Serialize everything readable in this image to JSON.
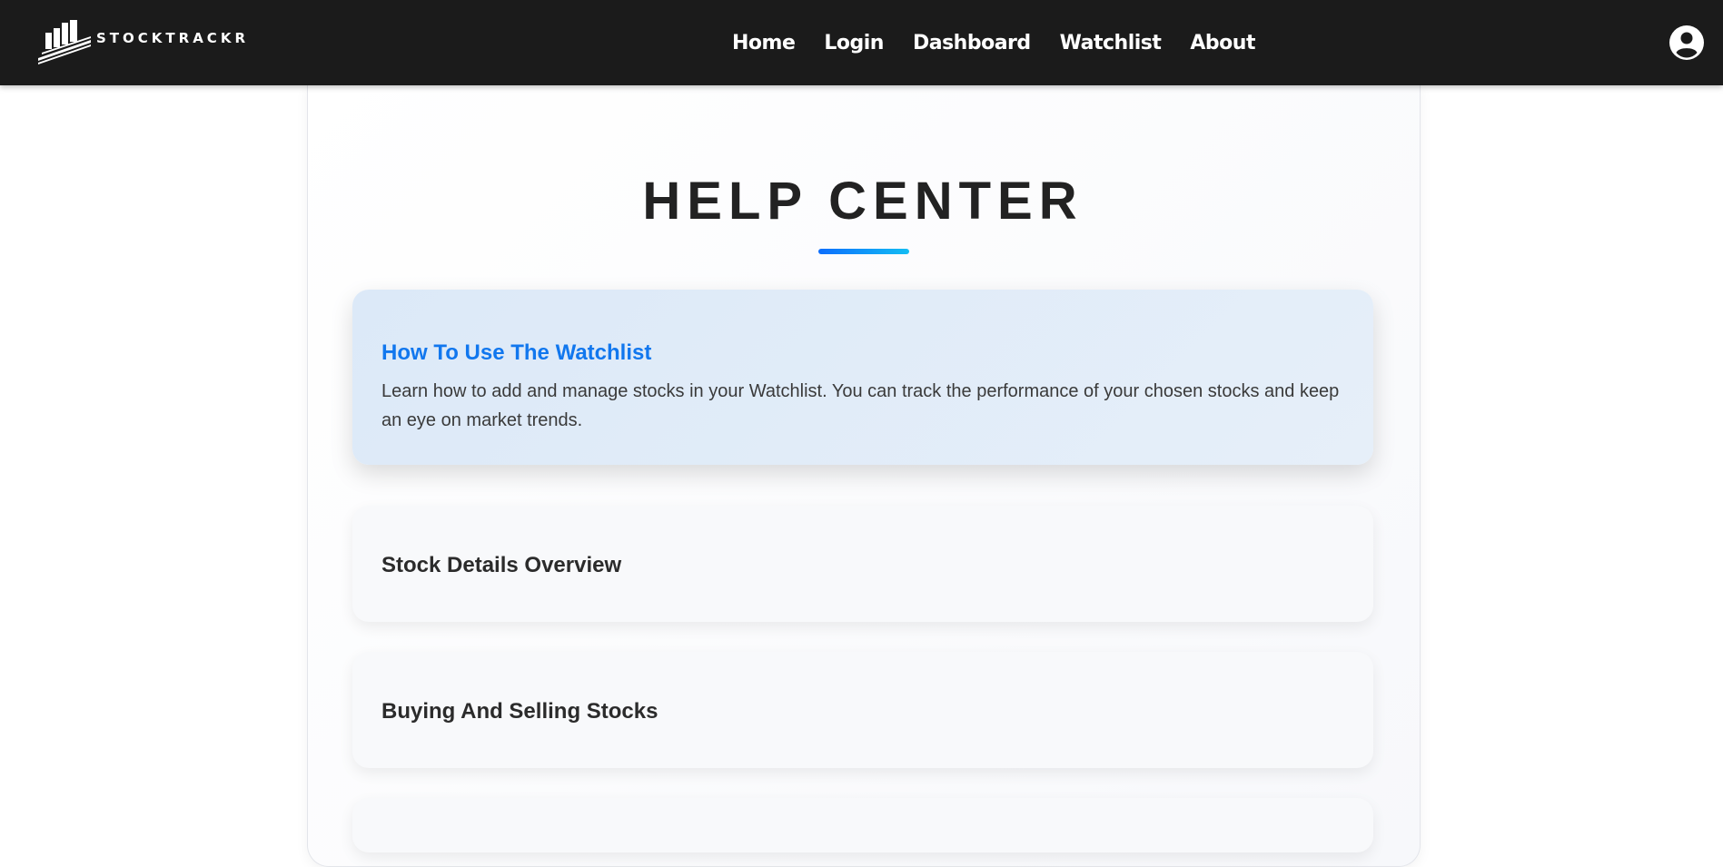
{
  "brand": {
    "logo_text": "STOCKTRACKR"
  },
  "nav": {
    "items": [
      {
        "label": "Home"
      },
      {
        "label": "Login"
      },
      {
        "label": "Dashboard"
      },
      {
        "label": "Watchlist"
      },
      {
        "label": "About"
      }
    ]
  },
  "user": {
    "avatar_icon": "user-circle-icon"
  },
  "main": {
    "title": "HELP CENTER",
    "accent_gradient": [
      "#0d6efd",
      "#13bdf3"
    ],
    "cards": [
      {
        "title": "How To Use The Watchlist",
        "description": "Learn how to add and manage stocks in your Watchlist. You can track the performance of your chosen stocks and keep an eye on market trends.",
        "expanded": true
      },
      {
        "title": "Stock Details Overview",
        "expanded": false
      },
      {
        "title": "Buying And Selling Stocks",
        "expanded": false
      }
    ]
  },
  "colors": {
    "navbar_bg": "#1b1b1b",
    "active_title": "#1177ee",
    "active_card_bg": "#dce9f8"
  }
}
